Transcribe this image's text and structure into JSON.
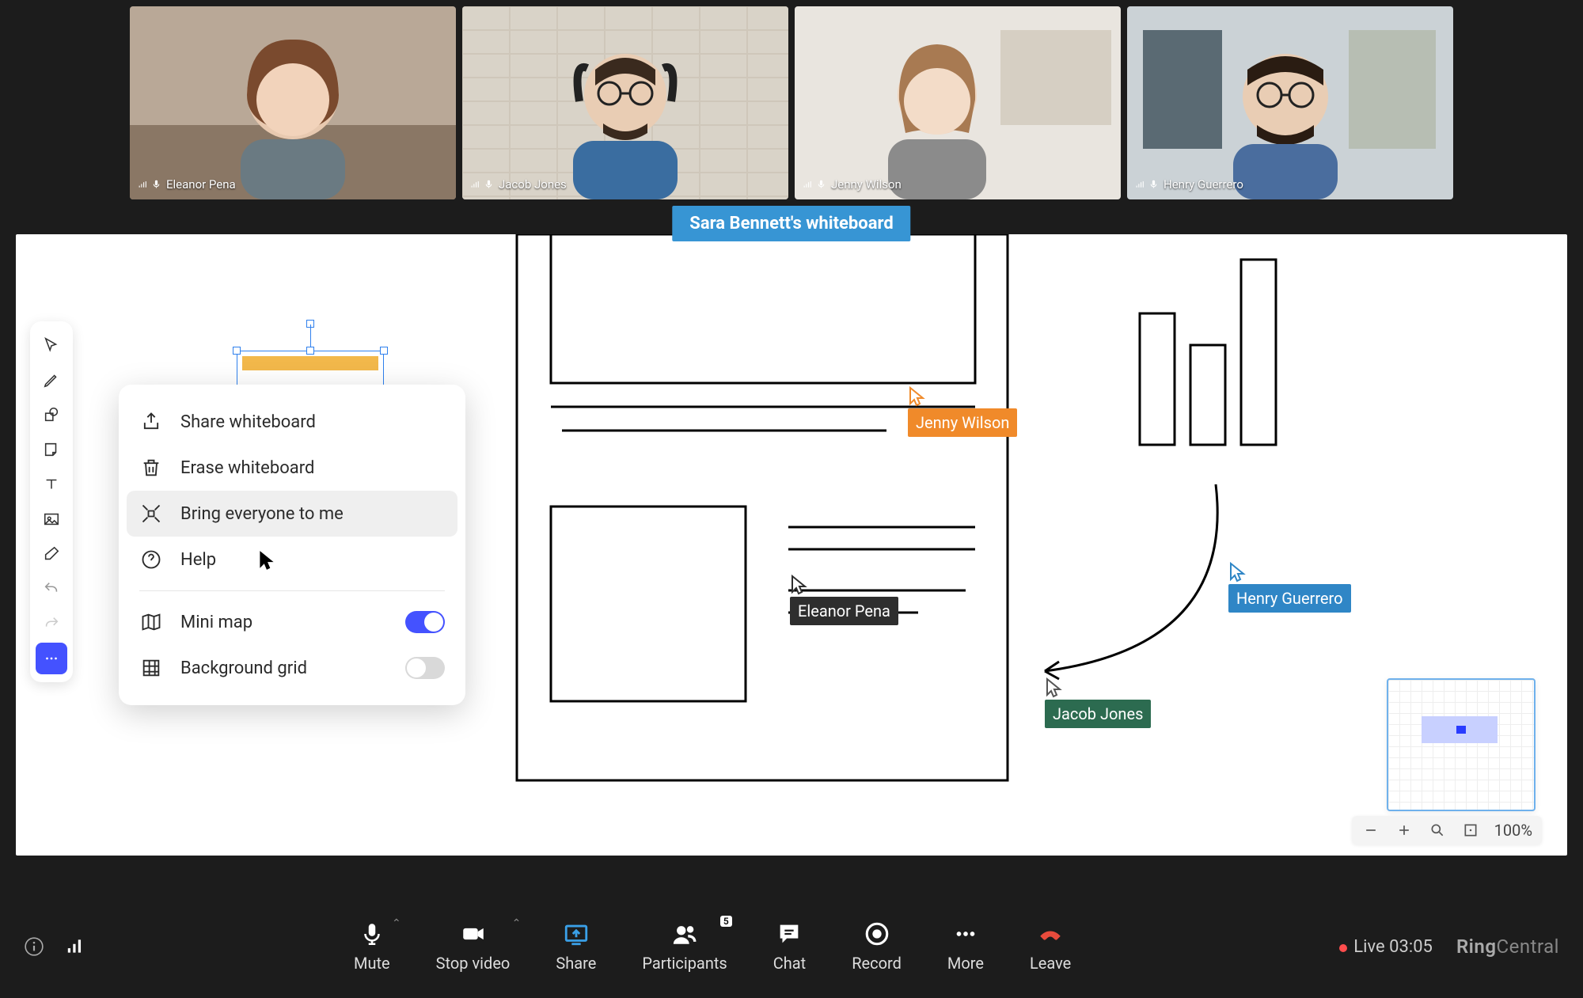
{
  "participants": [
    {
      "name": "Eleanor Pena"
    },
    {
      "name": "Jacob Jones"
    },
    {
      "name": "Jenny Wilson"
    },
    {
      "name": "Henry Guerrero"
    }
  ],
  "whiteboard": {
    "title": "Sara Bennett's whiteboard"
  },
  "options_menu": {
    "share": "Share whiteboard",
    "erase": "Erase whiteboard",
    "bring": "Bring everyone to me",
    "help": "Help",
    "minimap": "Mini map",
    "bg_grid": "Background grid",
    "minimap_on": true,
    "bg_grid_on": false
  },
  "collaborators": {
    "jenny": {
      "name": "Jenny Wilson",
      "color": "#f08a2a"
    },
    "eleanor": {
      "name": "Eleanor Pena",
      "color": "#2e2e2e"
    },
    "jacob": {
      "name": "Jacob Jones",
      "color": "#2c6b50"
    },
    "henry": {
      "name": "Henry Guerrero",
      "color": "#2f86c6"
    }
  },
  "zoom": {
    "level": "100%"
  },
  "meeting_controls": {
    "mute": "Mute",
    "stop_video": "Stop video",
    "share": "Share",
    "participants": "Participants",
    "participants_count": "5",
    "chat": "Chat",
    "record": "Record",
    "more": "More",
    "leave": "Leave"
  },
  "status": {
    "live_label": "Live",
    "timer": "03:05"
  },
  "brand": {
    "first": "Ring",
    "second": "Central"
  }
}
